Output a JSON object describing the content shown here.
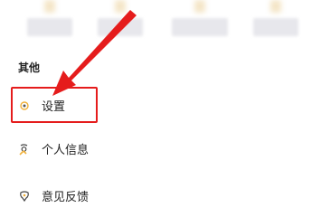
{
  "section": {
    "title": "其他"
  },
  "menu": {
    "items": [
      {
        "label": "设置",
        "icon": "settings-icon"
      },
      {
        "label": "个人信息",
        "icon": "personal-info-icon"
      },
      {
        "label": "意见反馈",
        "icon": "feedback-icon"
      }
    ]
  },
  "colors": {
    "accent": "#f0b03a",
    "highlight": "#e51c1c"
  }
}
